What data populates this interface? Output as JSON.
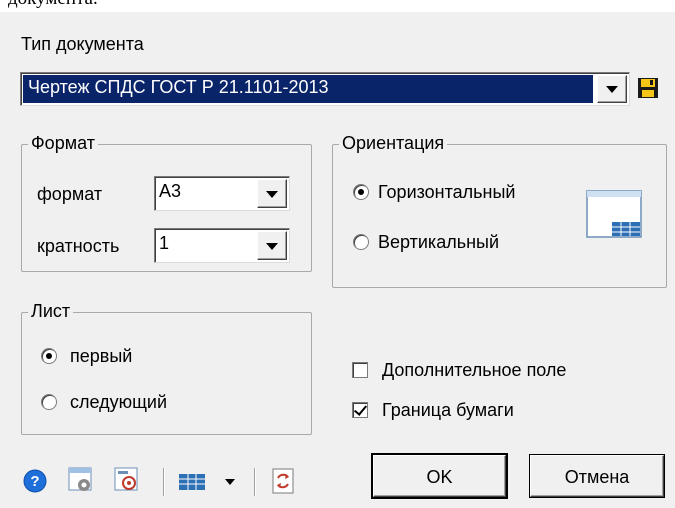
{
  "clipped_top_text": "документа.",
  "doc_type": {
    "label": "Тип документа",
    "selected": "Чертеж СПДС ГОСТ Р 21.1101-2013"
  },
  "format_group": {
    "title": "Формат",
    "format_label": "формат",
    "format_value": "А3",
    "multiplicity_label": "кратность",
    "multiplicity_value": "1"
  },
  "orientation_group": {
    "title": "Ориентация",
    "options": [
      {
        "label": "Горизонтальный",
        "selected": true
      },
      {
        "label": "Вертикальный",
        "selected": false
      }
    ]
  },
  "sheet_group": {
    "title": "Лист",
    "options": [
      {
        "label": "первый",
        "selected": true
      },
      {
        "label": "следующий",
        "selected": false
      }
    ]
  },
  "options": {
    "extra_field": {
      "label": "Дополнительное поле",
      "checked": false
    },
    "paper_border": {
      "label": "Граница бумаги",
      "checked": true
    }
  },
  "buttons": {
    "ok": "OK",
    "cancel": "Отмена"
  },
  "toolbar_icons": [
    "help-icon",
    "settings-icon",
    "stamp-icon",
    "table-icon",
    "dropdown-arrow-icon",
    "refresh-icon"
  ],
  "colors": {
    "selection": "#0a246a",
    "dialog_bg": "#f0f0f0",
    "help_blue": "#1e6fd9"
  }
}
